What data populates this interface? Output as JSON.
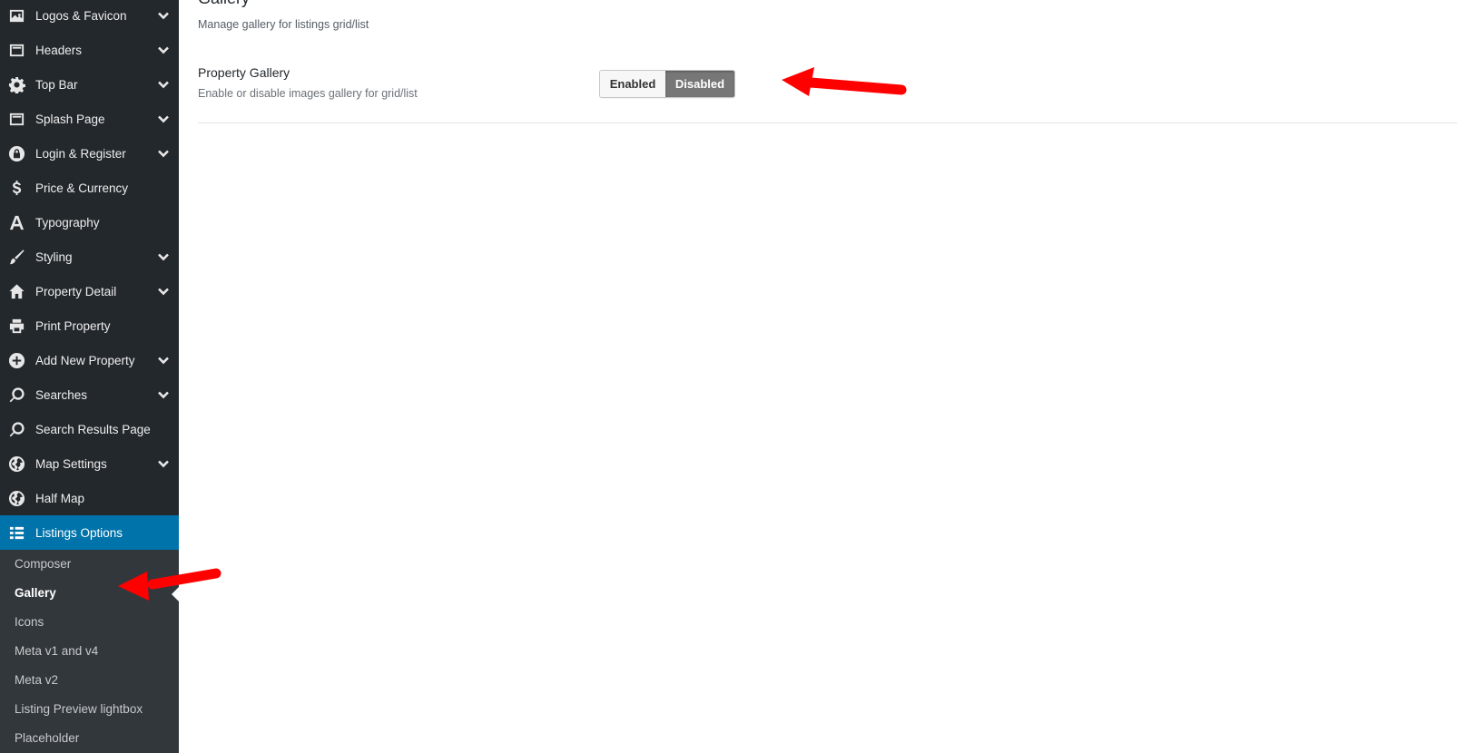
{
  "sidebar": {
    "items": [
      {
        "label": "Logos & Favicon",
        "icon": "image-icon",
        "has_submenu": true
      },
      {
        "label": "Headers",
        "icon": "layout-icon",
        "has_submenu": true
      },
      {
        "label": "Top Bar",
        "icon": "gear-icon",
        "has_submenu": true
      },
      {
        "label": "Splash Page",
        "icon": "layout-icon",
        "has_submenu": true
      },
      {
        "label": "Login & Register",
        "icon": "lock-icon",
        "has_submenu": true
      },
      {
        "label": "Price & Currency",
        "icon": "dollar-icon",
        "has_submenu": false
      },
      {
        "label": "Typography",
        "icon": "font-icon",
        "has_submenu": false
      },
      {
        "label": "Styling",
        "icon": "brush-icon",
        "has_submenu": true
      },
      {
        "label": "Property Detail",
        "icon": "home-icon",
        "has_submenu": true
      },
      {
        "label": "Print Property",
        "icon": "print-icon",
        "has_submenu": false
      },
      {
        "label": "Add New Property",
        "icon": "plus-circle-icon",
        "has_submenu": true
      },
      {
        "label": "Searches",
        "icon": "search-icon",
        "has_submenu": true
      },
      {
        "label": "Search Results Page",
        "icon": "search-icon",
        "has_submenu": false
      },
      {
        "label": "Map Settings",
        "icon": "globe-icon",
        "has_submenu": true
      },
      {
        "label": "Half Map",
        "icon": "globe-icon",
        "has_submenu": false
      },
      {
        "label": "Listings Options",
        "icon": "list-icon",
        "has_submenu": false,
        "active": true
      }
    ],
    "submenu": [
      {
        "label": "Composer"
      },
      {
        "label": "Gallery",
        "current": true
      },
      {
        "label": "Icons"
      },
      {
        "label": "Meta v1 and v4"
      },
      {
        "label": "Meta v2"
      },
      {
        "label": "Listing Preview lightbox"
      },
      {
        "label": "Placeholder"
      }
    ]
  },
  "main": {
    "section_title": "Gallery",
    "section_desc": "Manage gallery for listings grid/list",
    "field": {
      "title": "Property Gallery",
      "desc": "Enable or disable images gallery for grid/list",
      "options": [
        "Enabled",
        "Disabled"
      ],
      "selected": "Disabled"
    }
  },
  "colors": {
    "sidebar_bg": "#23282d",
    "submenu_bg": "#32373c",
    "active_bg": "#0073aa",
    "toggle_selected": "#777777",
    "annotation_arrow": "#ff0000"
  }
}
